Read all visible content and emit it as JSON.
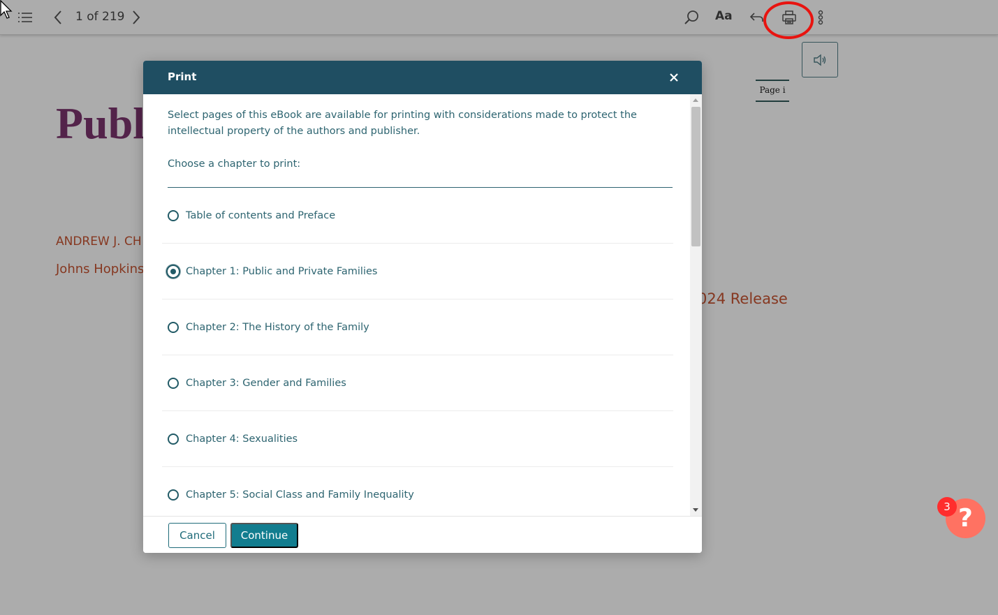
{
  "toolbar": {
    "page_count": "1 of 219",
    "font_button": "Aa"
  },
  "page": {
    "title_partial": "Publi",
    "author_partial": "ANDREW J. CH",
    "publisher_partial": "Johns Hopkins",
    "release_partial": "024 Release",
    "page_label": "Page i"
  },
  "help": {
    "badge_count": "3",
    "glyph": "?"
  },
  "modal": {
    "title": "Print",
    "intro": "Select pages of this eBook are available for printing with considerations made to protect the intellectual property of the authors and publisher.",
    "choose_label": "Choose a chapter to print:",
    "chapters": [
      {
        "label": "Table of contents and Preface",
        "selected": false
      },
      {
        "label": "Chapter 1: Public and Private Families",
        "selected": true
      },
      {
        "label": "Chapter 2: The History of the Family",
        "selected": false
      },
      {
        "label": "Chapter 3: Gender and Families",
        "selected": false
      },
      {
        "label": "Chapter 4: Sexualities",
        "selected": false
      },
      {
        "label": "Chapter 5: Social Class and Family Inequality",
        "selected": false
      }
    ],
    "cancel_label": "Cancel",
    "continue_label": "Continue"
  },
  "colors": {
    "header": "#1f4e62",
    "accent": "#127d8f",
    "highlight": "#e81410",
    "title_purple": "#6e1f5f",
    "author_orange": "#c1421c"
  }
}
